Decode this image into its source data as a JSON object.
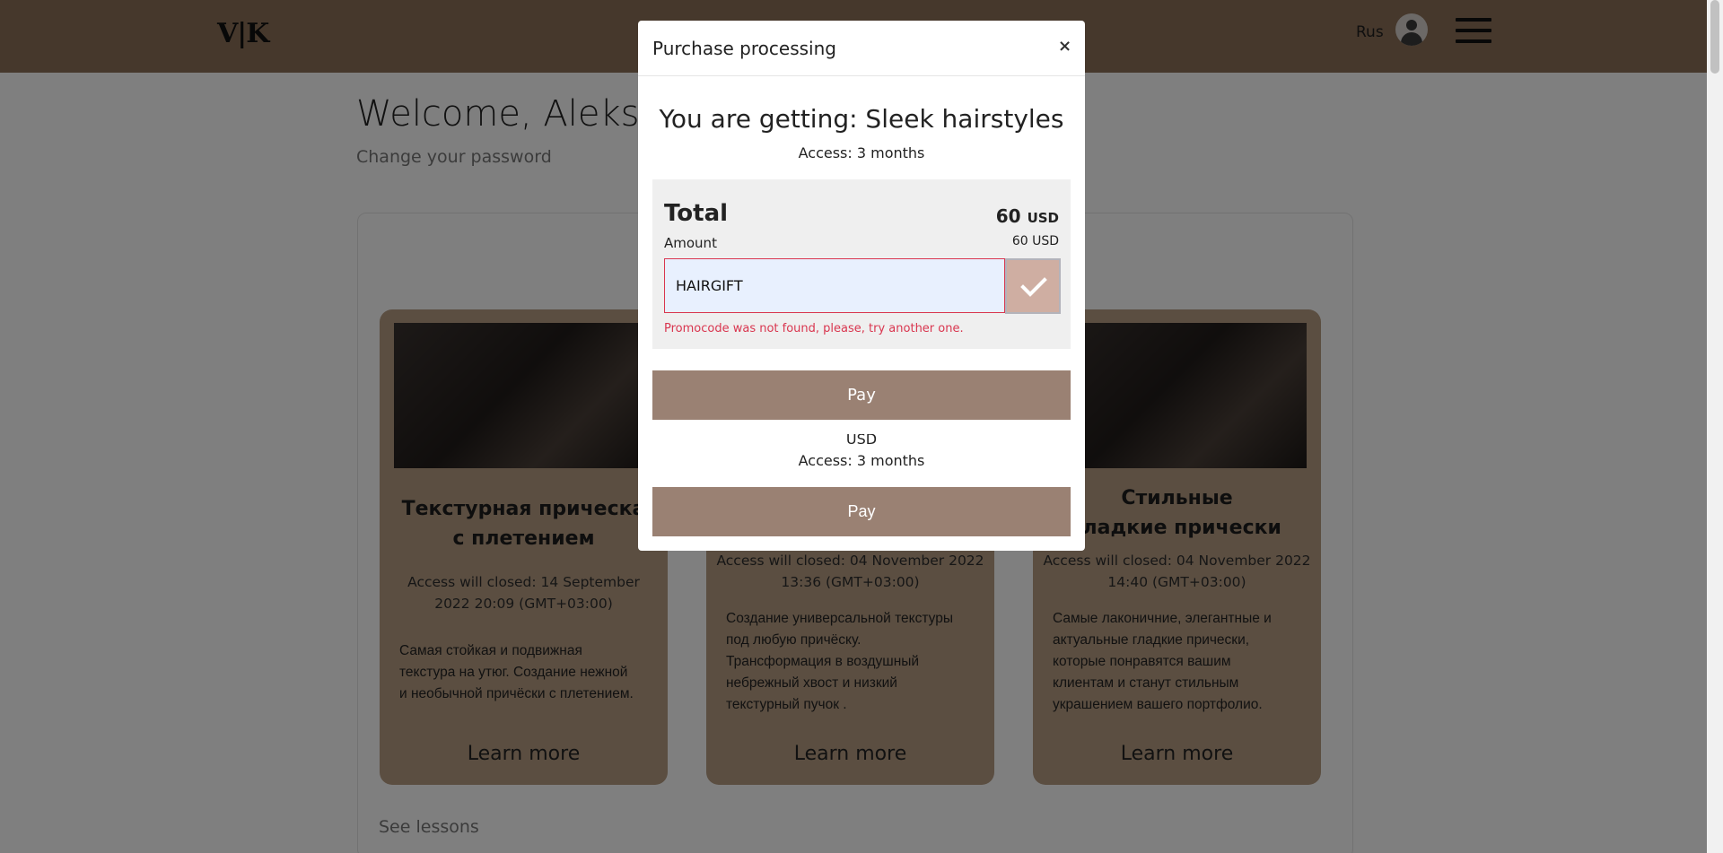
{
  "header": {
    "logo": "V|K",
    "language": "Rus"
  },
  "page": {
    "welcome": "Welcome, Aleksa",
    "change_password": "Change your password",
    "see_lessons": "See lessons"
  },
  "cards": [
    {
      "title_line1": "Текстурная прическа",
      "title_line2": "с плетением",
      "access_line1": "Access will closed: 14 September",
      "access_line2": "2022 20:09 (GMT+03:00)",
      "desc": [
        "Самая стойкая и подвижная",
        "текстура на утюг. Создание нежной",
        "и необычной причёски с плетением."
      ],
      "learn_more": "Learn more"
    },
    {
      "title_line1": "",
      "title_line2": "",
      "access_line1": "Access will closed: 04 November 2022",
      "access_line2": "13:36 (GMT+03:00)",
      "desc": [
        "Создание универсальной текстуры",
        "под любую причёску.",
        "Трансформация в воздушный",
        "небрежный хвост и низкий",
        "текстурный пучок ."
      ],
      "learn_more": "Learn more"
    },
    {
      "title_line1": "Стильные",
      "title_line2": "гладкие прически",
      "access_line1": "Access will closed: 04 November 2022",
      "access_line2": "14:40 (GMT+03:00)",
      "desc": [
        "Самые лаконичние, элегантные и",
        "актуальные гладкие прически,",
        "которые понравятся вашим",
        "клиентам и станут стильным",
        "украшением вашего портфолио."
      ],
      "learn_more": "Learn more"
    }
  ],
  "background_modal": {
    "currency": "USD",
    "access": "Access: 3 months",
    "pay": "Pay"
  },
  "modal": {
    "title": "Purchase processing",
    "close": "×",
    "getting": "You are getting: Sleek hairstyles",
    "access": "Access: 3 months",
    "total_label": "Total",
    "total_amount": "60",
    "total_currency": "USD",
    "amount_label": "Amount",
    "amount_value": "60 USD",
    "promo_value": "HAIRGIFT",
    "error": "Promocode was not found, please, try another one.",
    "pay": "Pay"
  },
  "colors": {
    "header": "#8c7058",
    "card": "#b79d83",
    "pay_button": "#9a8173",
    "apply_button": "#cfaea2",
    "error": "#d9364f"
  }
}
